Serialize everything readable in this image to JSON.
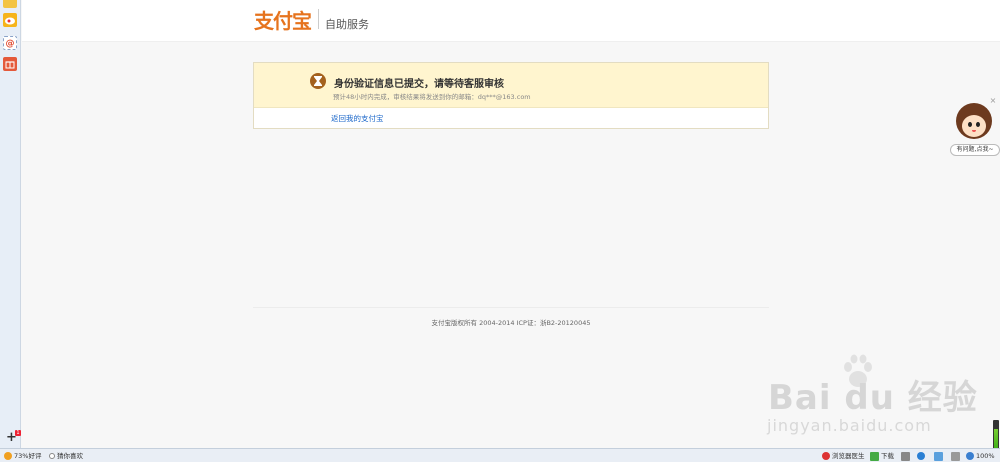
{
  "header": {
    "logo_text": "支付宝",
    "title": "自助服务"
  },
  "notice": {
    "title": "身份验证信息已提交，请等待客服审核",
    "subtitle": "预计48小时内完成，审核结果将发送到你的邮箱：dq***@163.com",
    "return_link": "返回我的支付宝"
  },
  "footer": {
    "copyright": "支付宝版权所有 2004-2014 ICP证：浙B2-20120045"
  },
  "cs_widget": {
    "label": "有问题,点我~",
    "close": "×"
  },
  "watermark": {
    "brand": "Bai du 经验",
    "url": "jingyan.baidu.com"
  },
  "status_bar": {
    "rating": "73%好评",
    "recommend": "猜你喜欢",
    "doctor": "浏览器医生",
    "download": "下载",
    "zoom": "100%"
  },
  "left_rail": {
    "add": "+",
    "add_badge": "1"
  },
  "colors": {
    "brand": "#e6731d",
    "notice_bg": "#fff5cf",
    "link": "#1a66c9"
  }
}
